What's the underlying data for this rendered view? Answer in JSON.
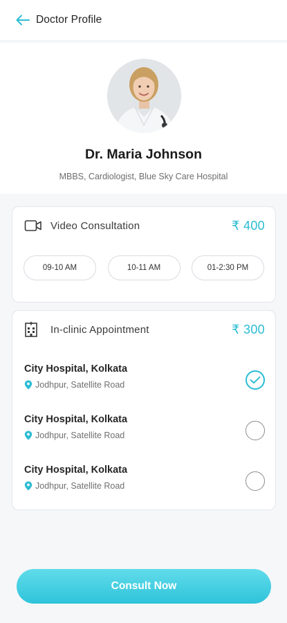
{
  "header": {
    "title": "Doctor Profile",
    "back_icon": "arrow-left-icon"
  },
  "doctor": {
    "name": "Dr. Maria Johnson",
    "qualifications": "MBBS, Cardiologist, Blue Sky Care Hospital"
  },
  "video": {
    "label": "Video Consultation",
    "price": "₹ 400",
    "icon": "video-camera-icon",
    "slots": [
      "09-10 AM",
      "10-11 AM",
      "01-2:30 PM"
    ]
  },
  "clinic": {
    "label": "In-clinic Appointment",
    "price": "₹ 300",
    "icon": "hospital-building-icon",
    "locations": [
      {
        "name": "City Hospital, Kolkata",
        "address": "Jodhpur, Satellite Road",
        "selected": true
      },
      {
        "name": "City Hospital, Kolkata",
        "address": "Jodhpur, Satellite Road",
        "selected": false
      },
      {
        "name": "City Hospital, Kolkata",
        "address": "Jodhpur, Satellite Road",
        "selected": false
      }
    ]
  },
  "actions": {
    "consult_label": "Consult Now"
  },
  "colors": {
    "accent": "#2bbcd3",
    "button_gradient_top": "#61dcea",
    "button_gradient_bottom": "#2ec3da"
  }
}
